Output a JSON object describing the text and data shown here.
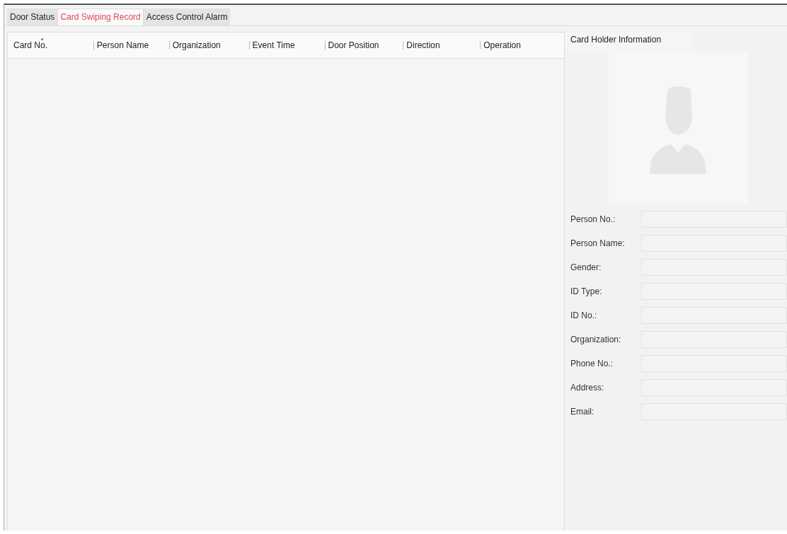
{
  "tabs": [
    {
      "label": "Door Status",
      "selected": false
    },
    {
      "label": "Card Swiping Record",
      "selected": true
    },
    {
      "label": "Access Control Alarm",
      "selected": false
    }
  ],
  "table": {
    "columns": [
      {
        "label": "Card No.",
        "sorted": true
      },
      {
        "label": "Person Name",
        "sorted": false
      },
      {
        "label": "Organization",
        "sorted": false
      },
      {
        "label": "Event Time",
        "sorted": false
      },
      {
        "label": "Door Position",
        "sorted": false
      },
      {
        "label": "Direction",
        "sorted": false
      },
      {
        "label": "Operation",
        "sorted": false
      }
    ]
  },
  "card_holder": {
    "title": "Card Holder Information",
    "fields": [
      {
        "label": "Person No.:"
      },
      {
        "label": "Person Name:"
      },
      {
        "label": "Gender:"
      },
      {
        "label": "ID Type:"
      },
      {
        "label": "ID No.:"
      },
      {
        "label": "Organization:"
      },
      {
        "label": "Phone No.:"
      },
      {
        "label": "Address:"
      },
      {
        "label": "Email:"
      }
    ]
  }
}
